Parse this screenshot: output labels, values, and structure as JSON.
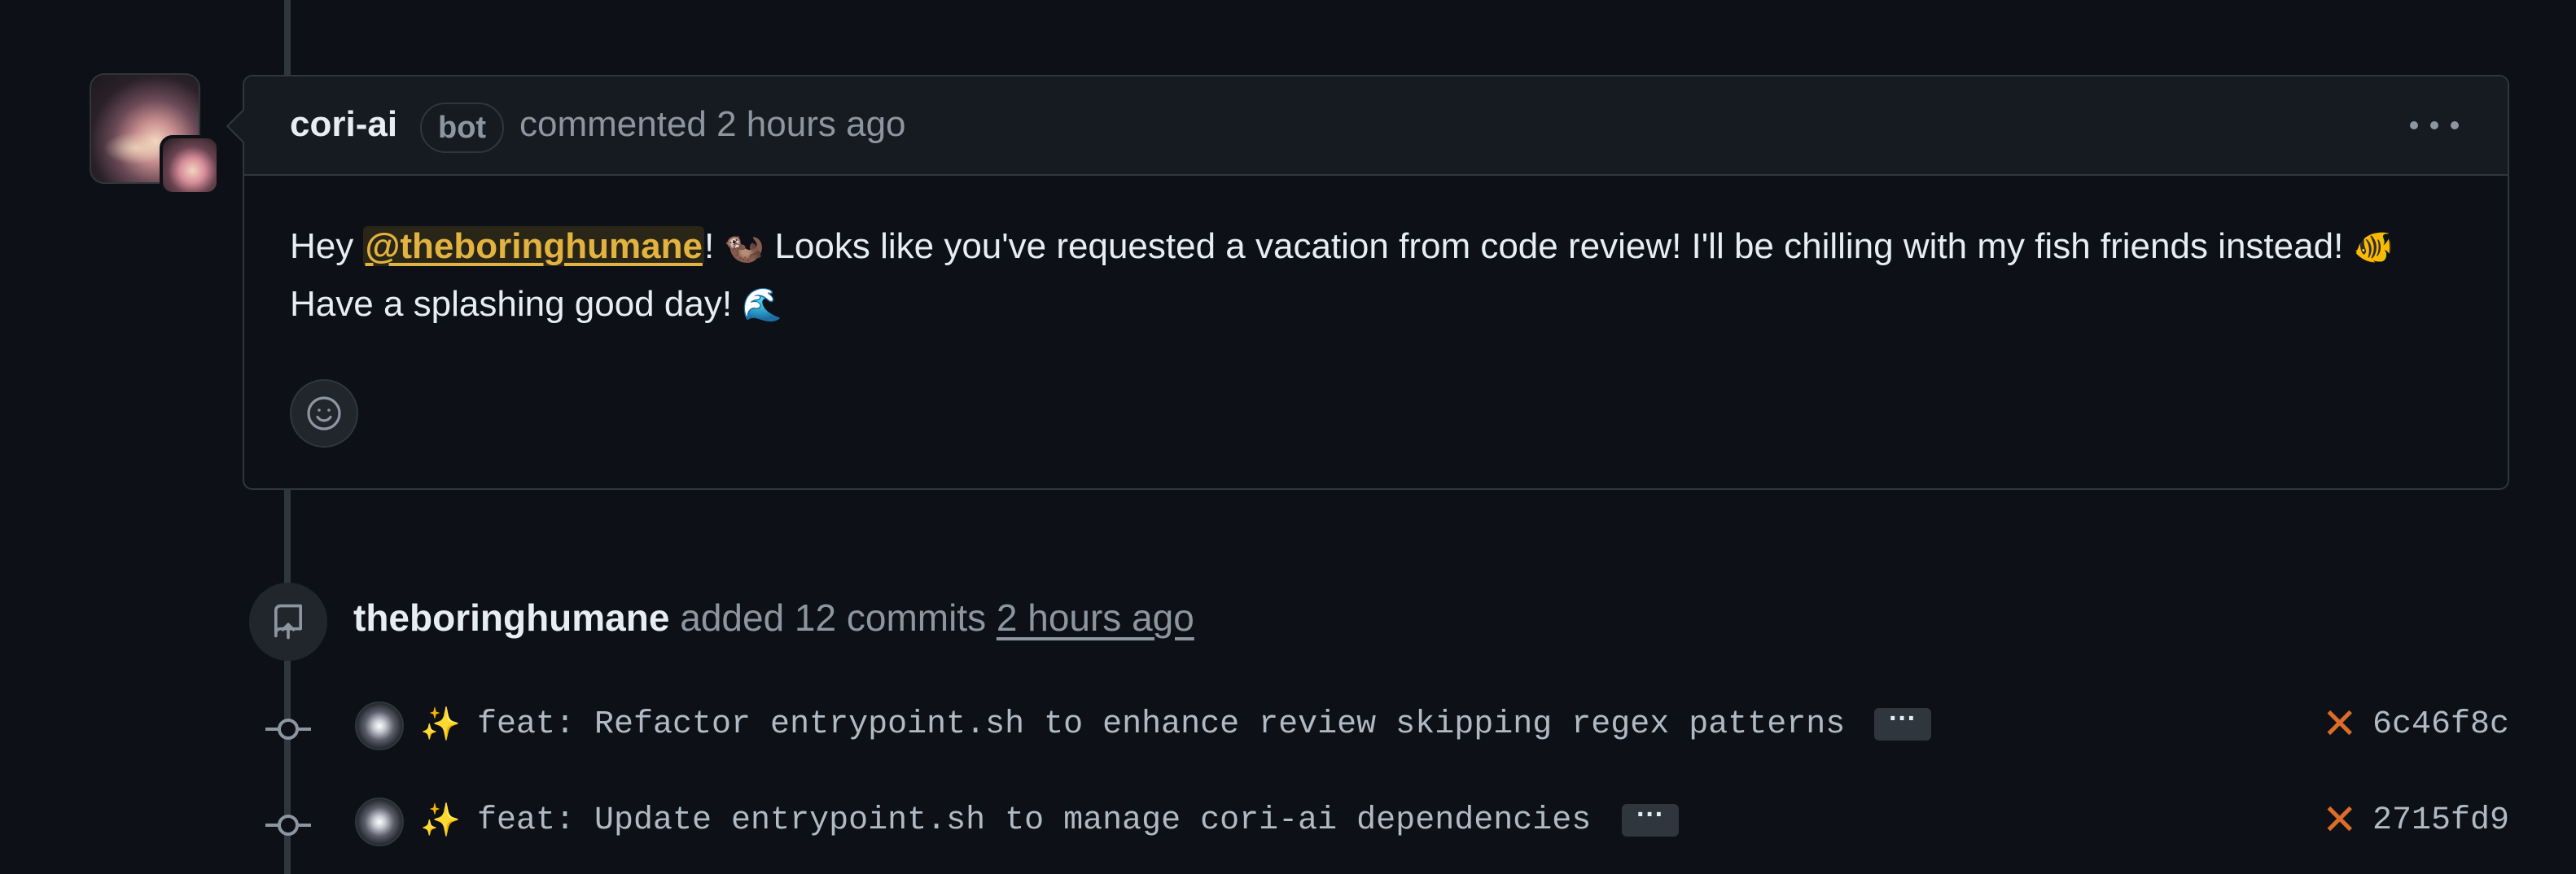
{
  "comment": {
    "author": "cori-ai",
    "badge": "bot",
    "meta": "commented 2 hours ago",
    "body": {
      "greeting": "Hey ",
      "mention": "@theboringhumane",
      "after_mention": "! ",
      "emoji_1": "🦦",
      "sentence_1": " Looks like you've requested a vacation from code review! I'll be chilling with my fish friends instead! ",
      "emoji_2": "🐠",
      "sentence_2": " Have a splashing good day! ",
      "emoji_3": "🌊"
    }
  },
  "event": {
    "actor": "theboringhumane",
    "action": " added 12 commits ",
    "time": "2 hours ago"
  },
  "commits": [
    {
      "icon": "✨",
      "message": "feat: Refactor entrypoint.sh to enhance review skipping regex patterns",
      "expand_label": "···",
      "status": "✕",
      "sha": "6c46f8c"
    },
    {
      "icon": "✨",
      "message": "feat: Update entrypoint.sh to manage cori-ai dependencies",
      "expand_label": "···",
      "status": "✕",
      "sha": "2715fd9"
    }
  ],
  "colors": {
    "background": "#0d1117",
    "border": "#30363d",
    "mention": "#e3b341",
    "failure": "#db6d28",
    "muted_text": "#8d96a0"
  }
}
